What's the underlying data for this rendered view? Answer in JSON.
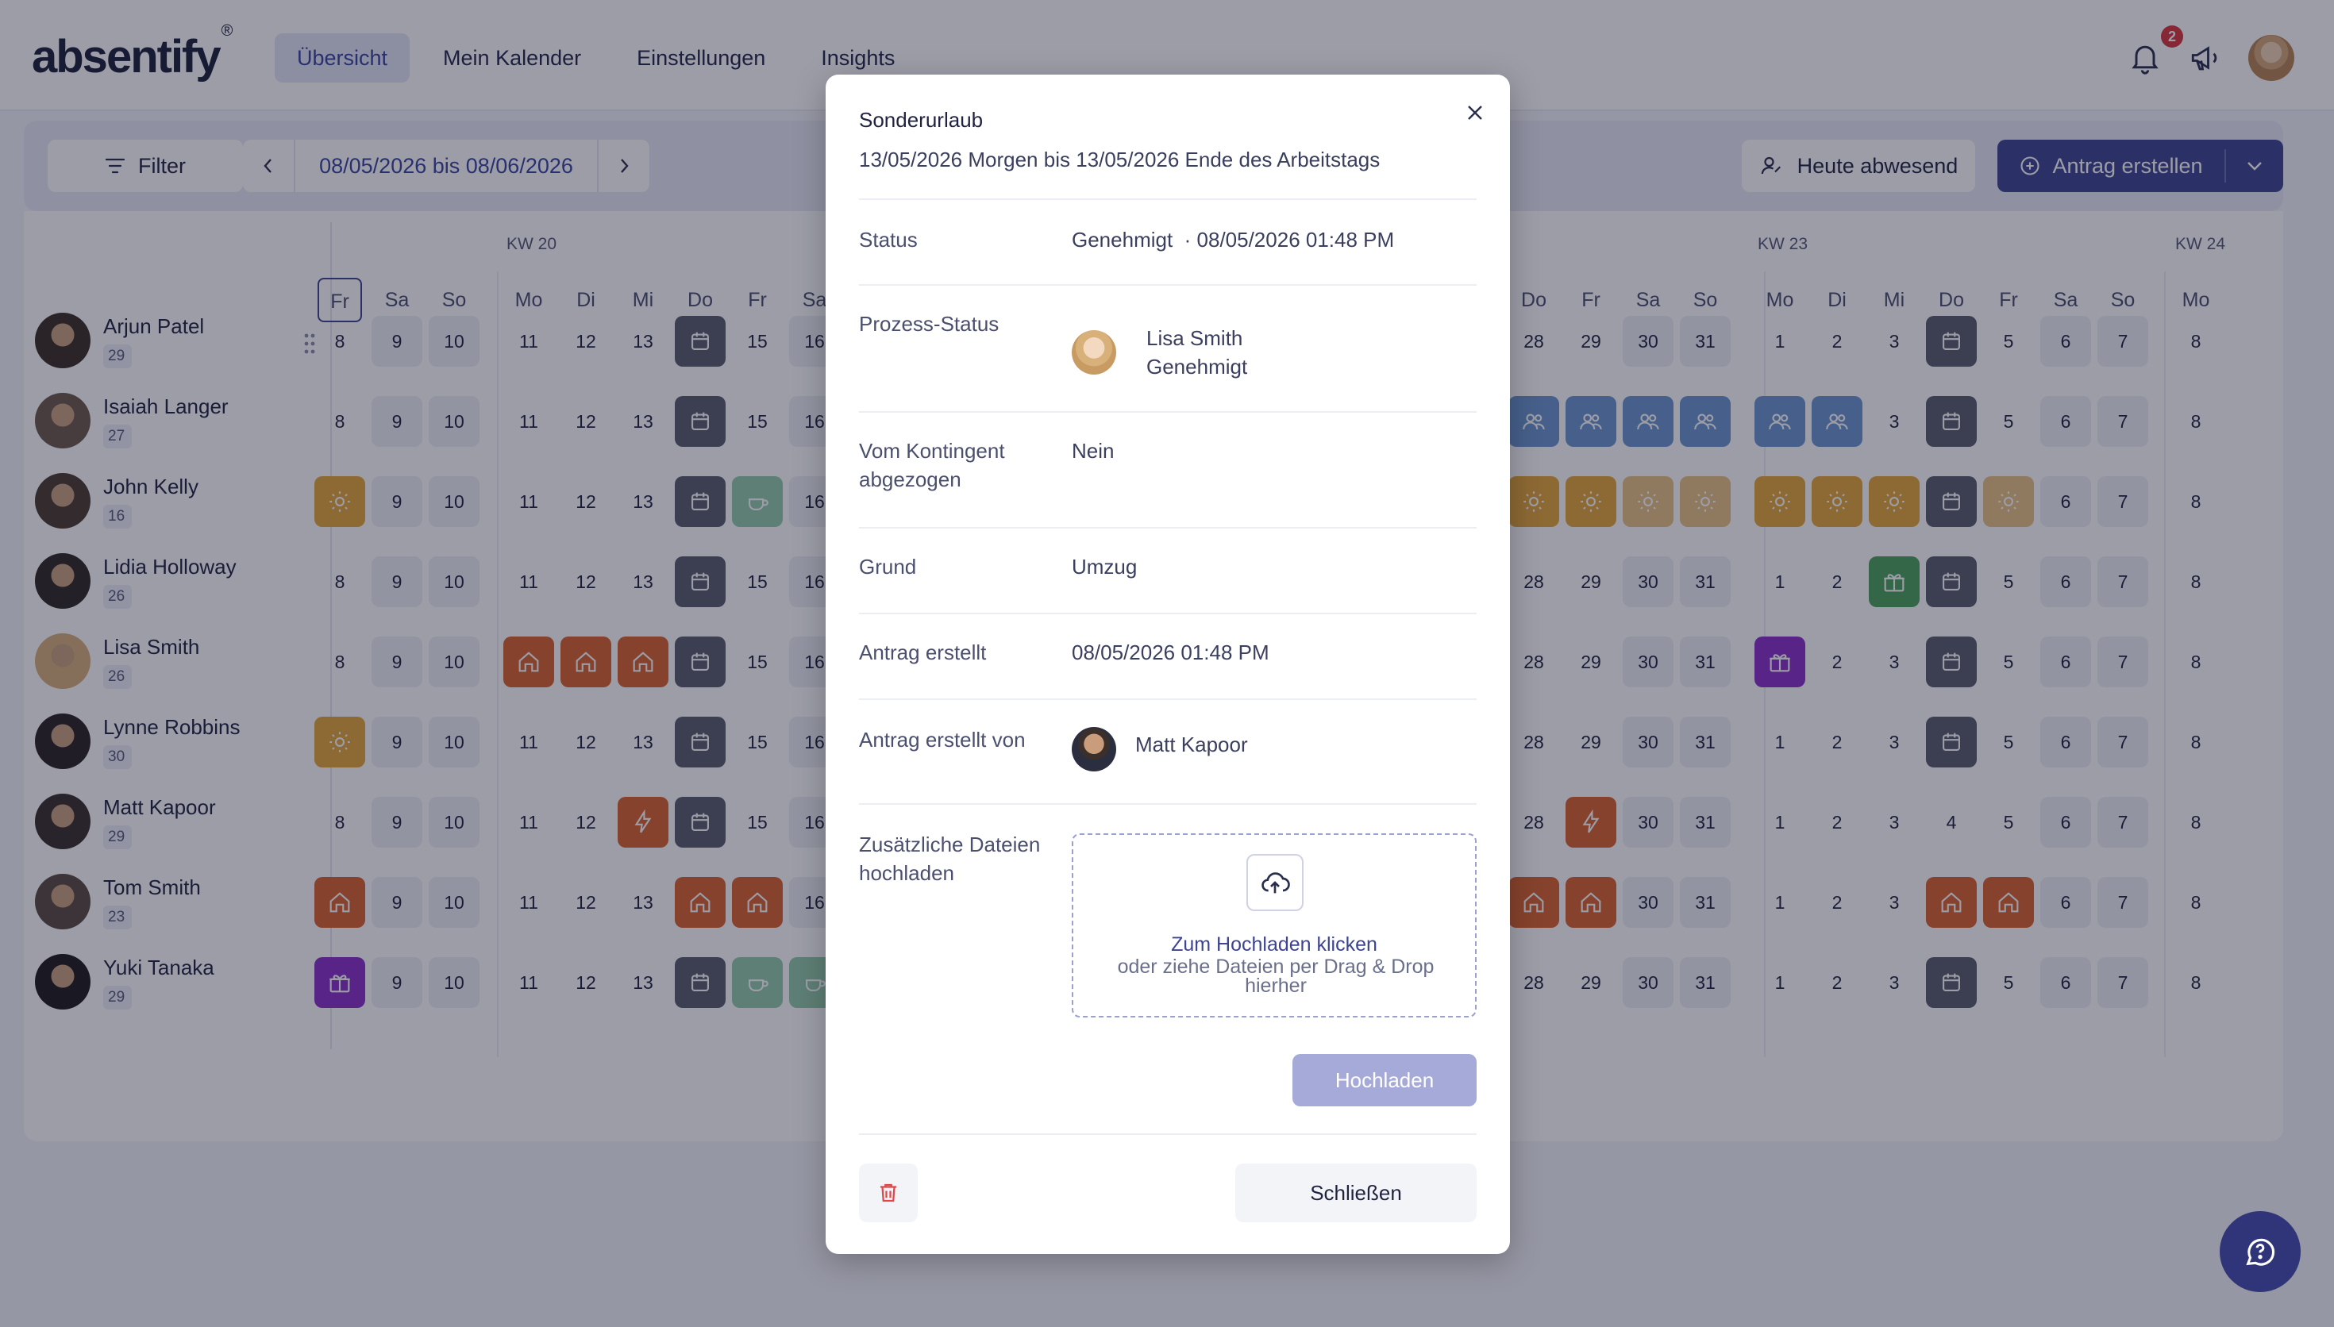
{
  "app": {
    "logo": "absentify",
    "logo_mark": "®"
  },
  "nav": {
    "items": [
      "Übersicht",
      "Mein Kalender",
      "Einstellungen",
      "Insights"
    ],
    "active": "Übersicht"
  },
  "header": {
    "notification_count": "2"
  },
  "toolbar": {
    "filter_label": "Filter",
    "date_range": "08/05/2026 bis 08/06/2026",
    "absent_today_label": "Heute abwesend",
    "create_request_label": "Antrag erstellen"
  },
  "calendar": {
    "weeks": [
      "KW 20",
      "KW 23",
      "KW 24"
    ],
    "employees": [
      {
        "name": "Arjun Patel",
        "count": "29"
      },
      {
        "name": "Isaiah Langer",
        "count": "27"
      },
      {
        "name": "John Kelly",
        "count": "16"
      },
      {
        "name": "Lidia Holloway",
        "count": "26"
      },
      {
        "name": "Lisa Smith",
        "count": "26"
      },
      {
        "name": "Lynne Robbins",
        "count": "30"
      },
      {
        "name": "Matt Kapoor",
        "count": "29"
      },
      {
        "name": "Tom Smith",
        "count": "23"
      },
      {
        "name": "Yuki Tanaka",
        "count": "29"
      }
    ]
  },
  "modal": {
    "title": "Sonderurlaub",
    "subtitle": "13/05/2026 Morgen bis 13/05/2026 Ende des Arbeitstags",
    "status_label": "Status",
    "status_value": "Genehmigt",
    "status_date": "· 08/05/2026 01:48 PM",
    "process_label": "Prozess-Status",
    "process_person": "Lisa Smith",
    "process_state": "Genehmigt",
    "quota_label": "Vom Kontingent abgezogen",
    "quota_value": "Nein",
    "reason_label": "Grund",
    "reason_value": "Umzug",
    "created_label": "Antrag erstellt",
    "created_value": "08/05/2026 01:48 PM",
    "created_by_label": "Antrag erstellt von",
    "created_by_value": "Matt Kapoor",
    "files_label": "Zusätzliche Dateien hochladen",
    "upload_link": "Zum Hochladen klicken",
    "upload_hint": "oder ziehe Dateien per Drag & Drop hierher",
    "upload_button": "Hochladen",
    "close_button": "Schließen"
  }
}
